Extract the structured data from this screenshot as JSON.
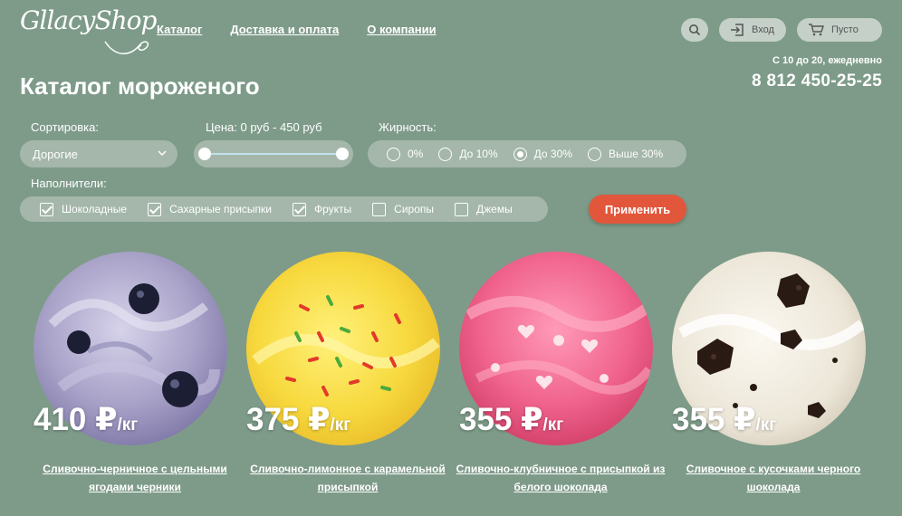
{
  "header": {
    "logo": "GllacyShop",
    "nav": [
      "Каталог",
      "Доставка и оплата",
      "О компании"
    ],
    "login_label": "Вход",
    "cart_label": "Пусто",
    "hours": "С 10 до 20, ежедневно",
    "phone": "8 812 450-25-25"
  },
  "page_title": "Каталог мороженого",
  "filters": {
    "sort_label": "Сортировка:",
    "sort_value": "Дорогие",
    "price_label": "Цена: 0 руб - 450 руб",
    "price_min": 0,
    "price_max": 450,
    "fat_label": "Жирность:",
    "fat_options": [
      "0%",
      "До 10%",
      "До 30%",
      "Выше 30%"
    ],
    "fat_selected": "До 30%",
    "fillers_label": "Наполнители:",
    "fillers": [
      {
        "label": "Шоколадные",
        "checked": true
      },
      {
        "label": "Сахарные присыпки",
        "checked": true
      },
      {
        "label": "Фрукты",
        "checked": true
      },
      {
        "label": "Сиропы",
        "checked": false
      },
      {
        "label": "Джемы",
        "checked": false
      }
    ],
    "apply_label": "Применить"
  },
  "products": [
    {
      "price": "410 ₽",
      "unit": "/кг",
      "name": "Сливочно-черничное с цельными ягодами черники"
    },
    {
      "price": "375 ₽",
      "unit": "/кг",
      "name": "Сливочно-лимонное с карамельной присыпкой"
    },
    {
      "price": "355 ₽",
      "unit": "/кг",
      "name": "Сливочно-клубничное с присыпкой из белого шоколада"
    },
    {
      "price": "355 ₽",
      "unit": "/кг",
      "name": "Сливочное с кусочками черного шоколада"
    }
  ],
  "colors": {
    "background": "#7e9b89",
    "control_bg": "#a4b7aa",
    "accent_button": "#e2573c",
    "header_pill": "#c5d0c8"
  },
  "icons": [
    "search-icon",
    "login-icon",
    "cart-icon",
    "chevron-down-icon"
  ]
}
